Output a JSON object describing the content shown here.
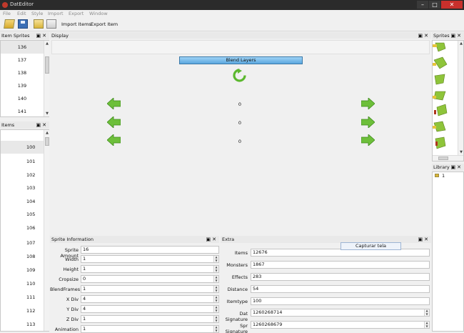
{
  "window": {
    "title": "DatEditor"
  },
  "menu": [
    "File",
    "Edit",
    "Style",
    "Import",
    "Export",
    "Window"
  ],
  "toolbar": {
    "import_label": "Import Items",
    "export_label": "Export Item"
  },
  "panels": {
    "item_sprites": {
      "title": "Item Sprites",
      "rows": [
        "136",
        "137",
        "138",
        "139",
        "140",
        "141"
      ]
    },
    "items": {
      "title": "Items",
      "rows": [
        "100",
        "101",
        "102",
        "103",
        "104",
        "105",
        "106",
        "107",
        "108",
        "109",
        "110",
        "111",
        "112",
        "113"
      ]
    },
    "display": {
      "title": "Display",
      "blend_label": "Blend Layers",
      "values": [
        "0",
        "0",
        "0"
      ]
    },
    "sprites": {
      "title": "Sprites"
    },
    "library": {
      "title": "Library",
      "items": [
        "1"
      ]
    },
    "sprite_info": {
      "title": "Sprite Information",
      "fields": [
        {
          "label": "Sprite Amount",
          "value": "16"
        },
        {
          "label": "Width",
          "value": "1"
        },
        {
          "label": "Height",
          "value": "1"
        },
        {
          "label": "Cropsize",
          "value": "0"
        },
        {
          "label": "BlendFrames",
          "value": "1"
        },
        {
          "label": "X Div",
          "value": "4"
        },
        {
          "label": "Y Div",
          "value": "4"
        },
        {
          "label": "Z Div",
          "value": "1"
        },
        {
          "label": "Animation",
          "value": "1"
        }
      ]
    },
    "extra": {
      "title": "Extra",
      "fields": [
        {
          "label": "Items",
          "value": "12676"
        },
        {
          "label": "Monsters",
          "value": "1867"
        },
        {
          "label": "Effects",
          "value": "283"
        },
        {
          "label": "Distance",
          "value": "54"
        },
        {
          "label": "Itemtype",
          "value": "100"
        },
        {
          "label": "Dat Signature",
          "value": "1260268714"
        },
        {
          "label": "Spr Signature",
          "value": "1260268679"
        }
      ]
    }
  },
  "tooltip": "Capturar tela",
  "colors": {
    "accent": "#5aa7de",
    "arrow_green": "#6dbf3a",
    "titlebar": "#2b2b2b"
  },
  "icons": {
    "window_controls": [
      "minimize-icon",
      "maximize-icon",
      "close-icon"
    ],
    "dock_buttons": [
      "float-icon",
      "close-icon"
    ]
  }
}
